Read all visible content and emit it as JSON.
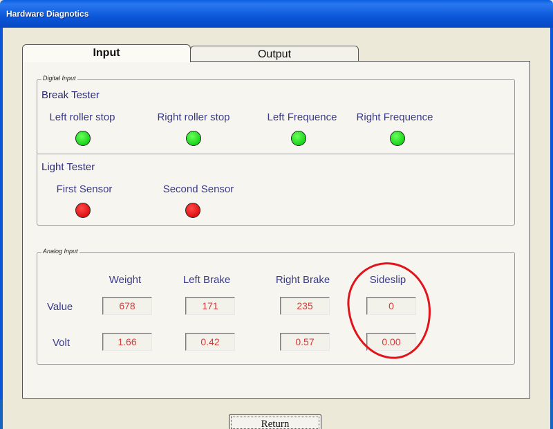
{
  "window": {
    "title": "Hardware Diagnotics"
  },
  "tabs": [
    {
      "label": "Input"
    },
    {
      "label": "Output"
    }
  ],
  "digital_input": {
    "legend": "Digital Input",
    "break_tester": {
      "label": "Break Tester",
      "indicators": [
        {
          "label": "Left roller stop",
          "state": "green"
        },
        {
          "label": "Right roller stop",
          "state": "green"
        },
        {
          "label": "Left Frequence",
          "state": "green"
        },
        {
          "label": "Right Frequence",
          "state": "green"
        }
      ]
    },
    "light_tester": {
      "label": "Light Tester",
      "indicators": [
        {
          "label": "First Sensor",
          "state": "red"
        },
        {
          "label": "Second Sensor",
          "state": "red"
        }
      ]
    }
  },
  "analog_input": {
    "legend": "Analog Input",
    "columns": [
      "Weight",
      "Left Brake",
      "Right Brake",
      "Sideslip"
    ],
    "rows": [
      {
        "label": "Value",
        "values": [
          "678",
          "171",
          "235",
          "0"
        ]
      },
      {
        "label": "Volt",
        "values": [
          "1.66",
          "0.42",
          "0.57",
          "0.00"
        ]
      }
    ]
  },
  "buttons": {
    "return_label": "Return"
  },
  "colors": {
    "led_green": "#19d41a",
    "led_red": "#e01010",
    "value_text": "#d63a3a",
    "annotation": "#e0141a"
  }
}
